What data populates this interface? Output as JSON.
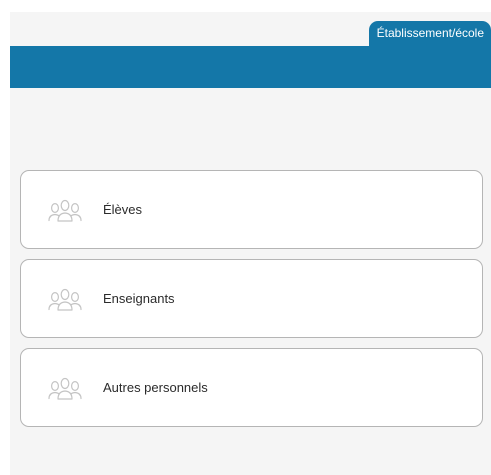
{
  "tabs": [
    {
      "label": "Établissement/école",
      "active": true
    }
  ],
  "categories": [
    {
      "label": "Élèves",
      "icon": "users-group-icon"
    },
    {
      "label": "Enseignants",
      "icon": "users-group-icon"
    },
    {
      "label": "Autres personnels",
      "icon": "users-group-icon"
    }
  ],
  "colors": {
    "accent": "#1477a8",
    "panel_background": "#f5f5f5",
    "card_border": "#b5b5b5",
    "icon": "#c4c4c4"
  }
}
